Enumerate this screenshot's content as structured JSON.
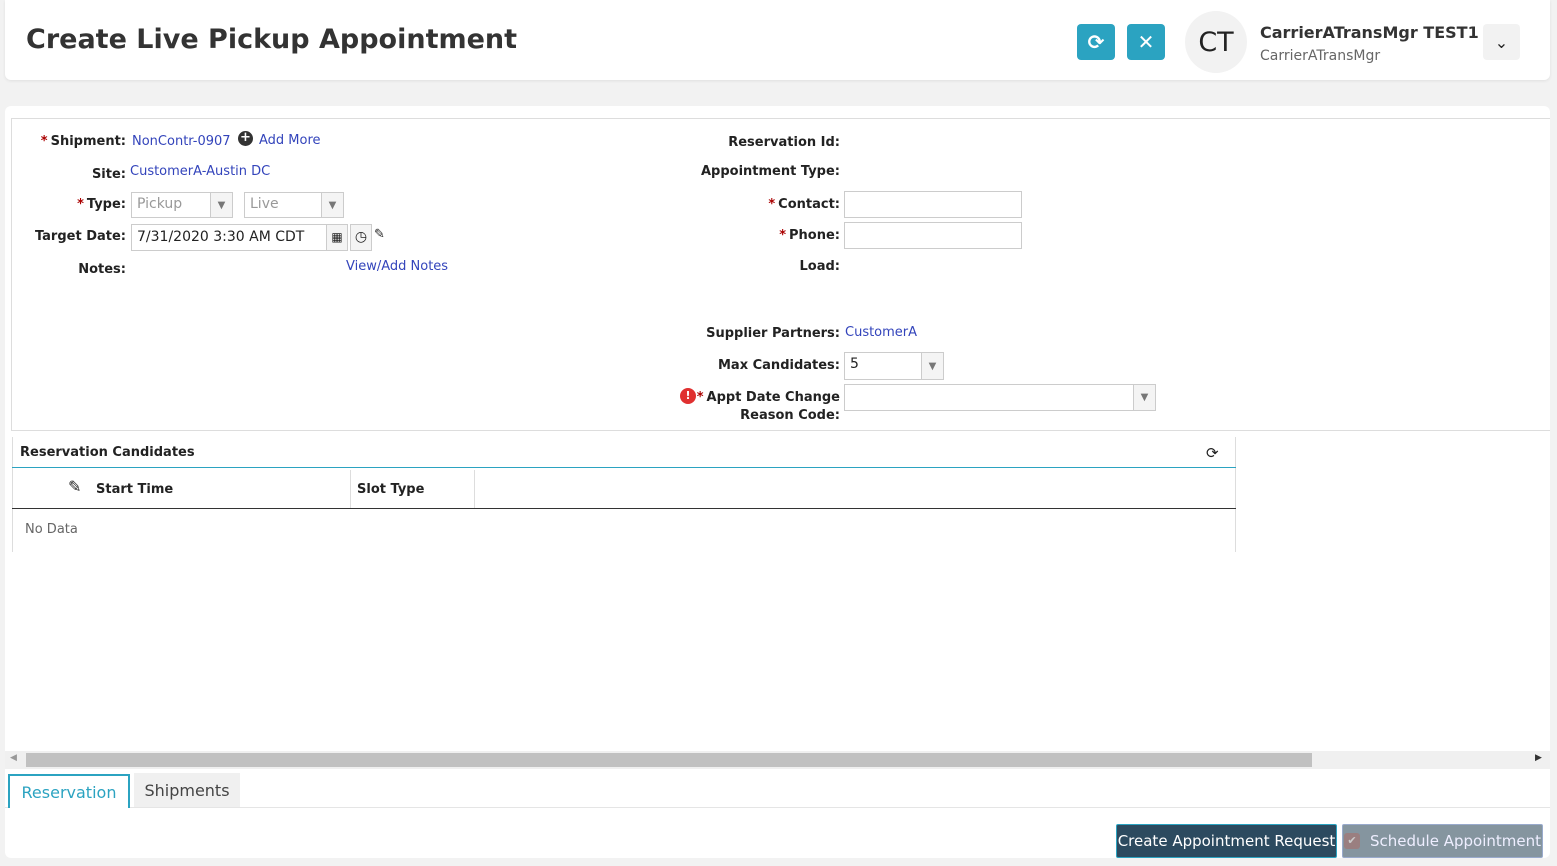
{
  "header": {
    "title": "Create Live Pickup Appointment",
    "avatar_initials": "CT",
    "user_name": "CarrierATransMgr TEST1",
    "user_login": "CarrierATransMgr"
  },
  "form": {
    "shipment_label": "Shipment:",
    "shipment_value": "NonContr-0907",
    "add_more": "Add More",
    "site_label": "Site:",
    "site_value": "CustomerA-Austin DC",
    "type_label": "Type:",
    "type_value": "Pickup",
    "type2_value": "Live",
    "target_date_label": "Target Date:",
    "target_date_value": "7/31/2020 3:30 AM CDT",
    "notes_label": "Notes:",
    "notes_link": "View/Add Notes",
    "reservation_id_label": "Reservation Id:",
    "appointment_type_label": "Appointment Type:",
    "contact_label": "Contact:",
    "contact_value": "",
    "phone_label": "Phone:",
    "phone_value": "",
    "load_label": "Load:",
    "supplier_partners_label": "Supplier Partners:",
    "supplier_partners_value": "CustomerA",
    "max_candidates_label": "Max Candidates:",
    "max_candidates_value": "5",
    "reason_code_label_1": "Appt Date Change",
    "reason_code_label_2": "Reason Code:",
    "reason_code_value": "",
    "required_mark": "*"
  },
  "grid": {
    "title": "Reservation Candidates",
    "columns": [
      "Start Time",
      "Slot Type"
    ],
    "empty": "No Data"
  },
  "tabs": [
    {
      "label": "Reservation",
      "active": true
    },
    {
      "label": "Shipments",
      "active": false
    }
  ],
  "actions": {
    "create": "Create Appointment Request",
    "schedule": "Schedule Appointment"
  },
  "colors": {
    "accent": "#2ba3c1",
    "primary_button": "#2c4a5f",
    "link": "#3344bb"
  }
}
